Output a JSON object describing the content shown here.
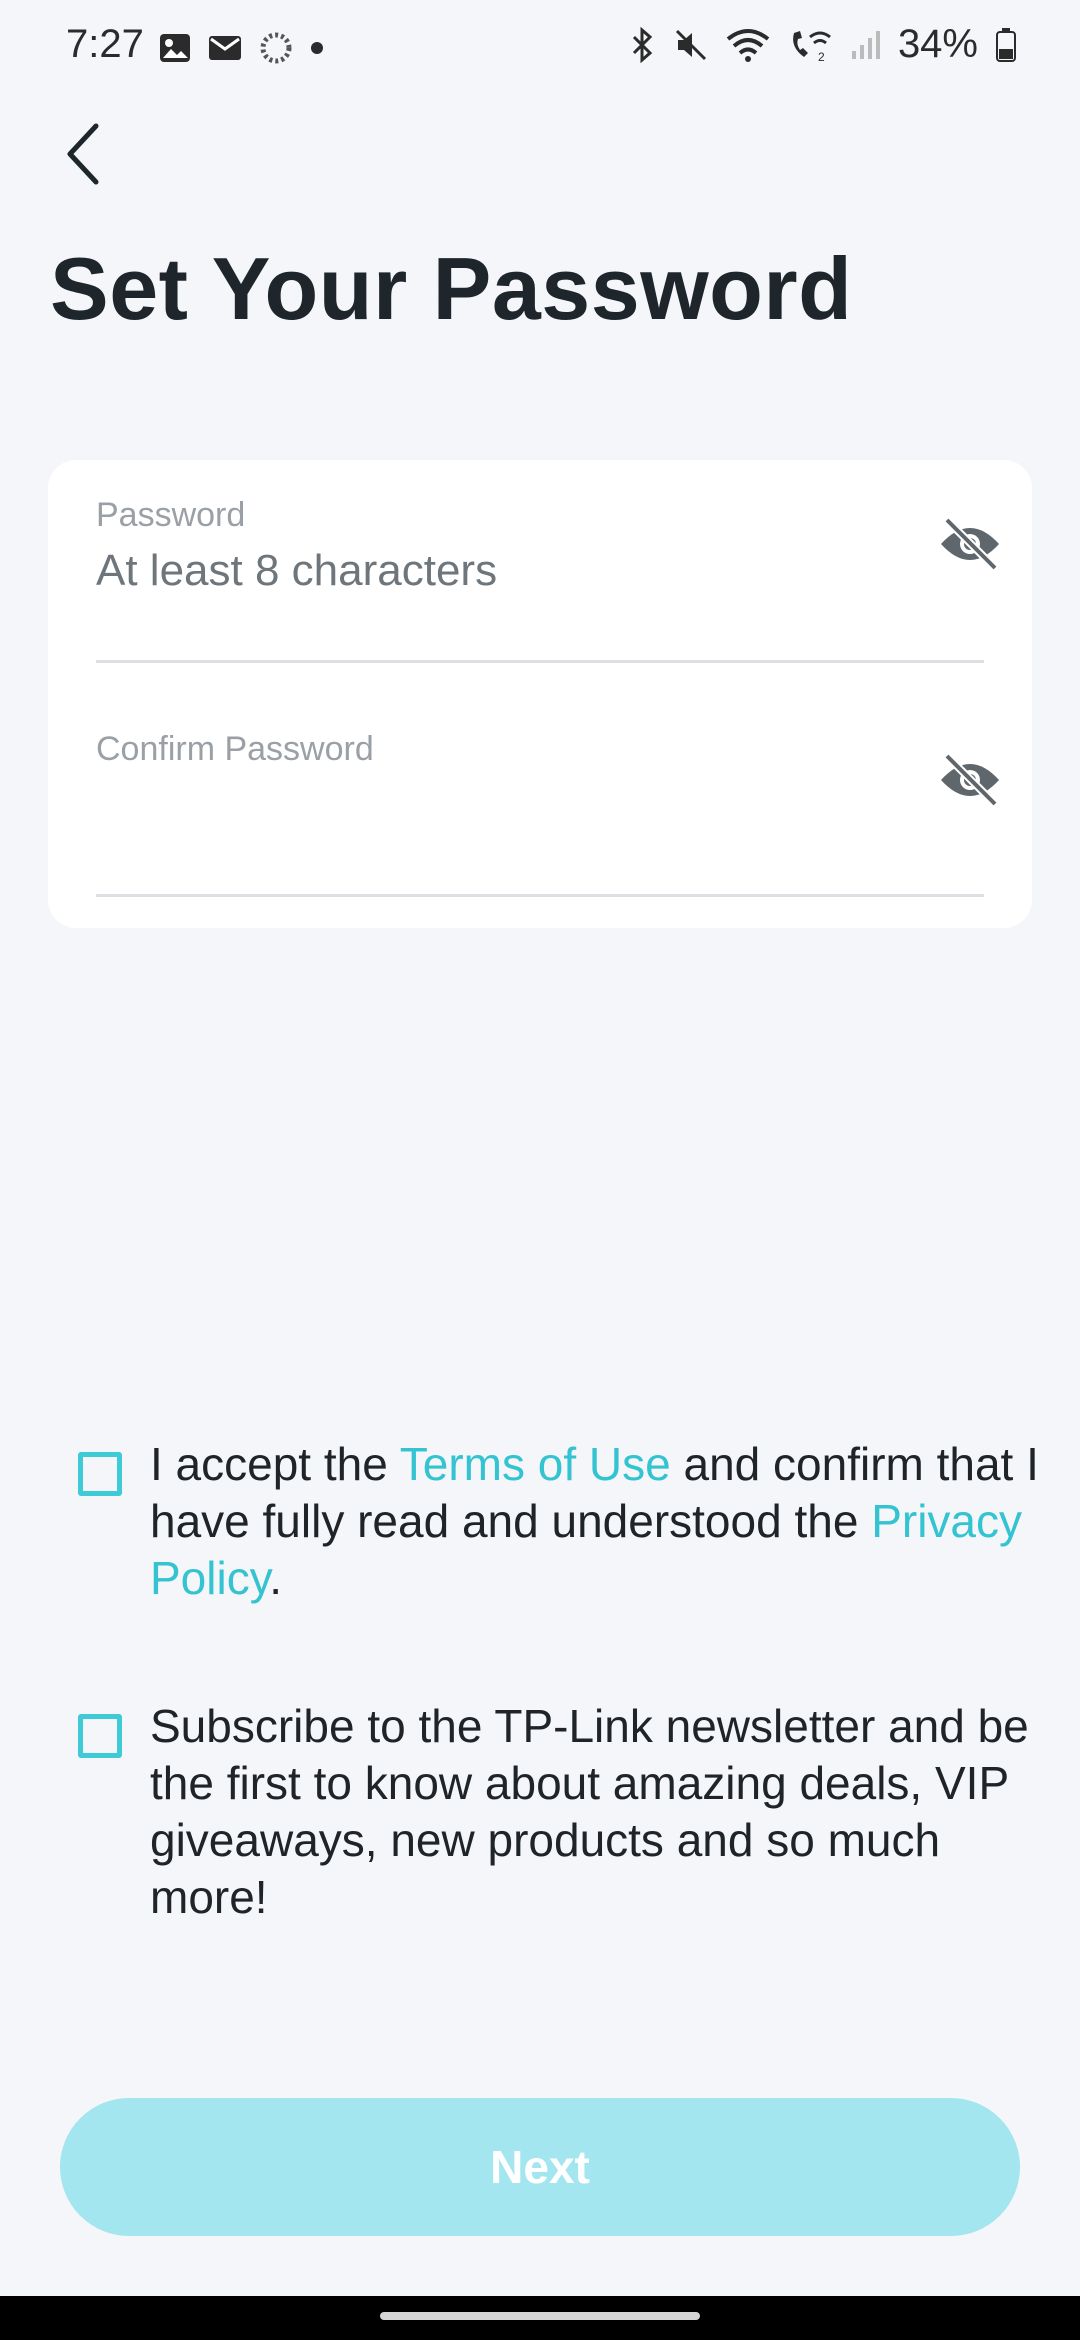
{
  "status_bar": {
    "time": "7:27",
    "battery": "34%",
    "icons_left": [
      "image-icon",
      "mail-icon",
      "loading-icon",
      "dot-icon"
    ],
    "icons_right": [
      "bluetooth-icon",
      "mute-icon",
      "wifi-icon",
      "wifi-call-icon",
      "signal-icon",
      "battery-icon"
    ]
  },
  "header": {
    "title": "Set Your Password"
  },
  "form": {
    "password": {
      "label": "Password",
      "placeholder": "At least 8 characters"
    },
    "confirm": {
      "label": "Confirm Password",
      "placeholder": ""
    }
  },
  "terms": {
    "prefix": "I accept the ",
    "terms_link": "Terms of Use",
    "middle": " and confirm that I have fully read and understood the ",
    "privacy_link": "Privacy Policy",
    "suffix": ".",
    "checked": false
  },
  "newsletter": {
    "text": "Subscribe to the TP-Link newsletter and be the first to know about amazing deals, VIP giveaways, new products and so much more!",
    "checked": false
  },
  "actions": {
    "next_label": "Next",
    "enabled": false
  },
  "colors": {
    "accent": "#33c3d1",
    "button_disabled": "#a3e6ef",
    "background": "#f4f6fa"
  }
}
